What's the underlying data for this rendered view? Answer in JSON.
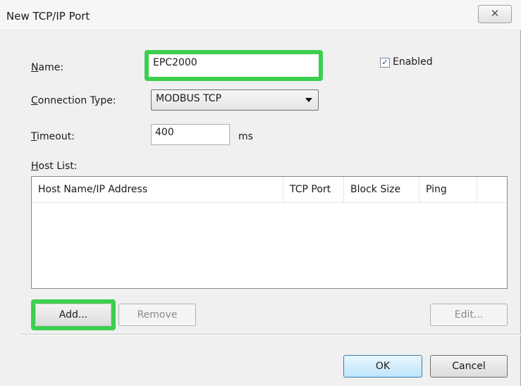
{
  "window": {
    "title": "New TCP/IP Port",
    "close_label": "✕"
  },
  "form": {
    "name_label": "Name:",
    "name_value": "EPC2000",
    "enabled_label": "Enabled",
    "enabled_checked": true,
    "connection_type_label": "Connection Type:",
    "connection_type_value": "MODBUS TCP",
    "timeout_label": "Timeout:",
    "timeout_value": "400",
    "timeout_unit": "ms",
    "host_list_label": "Host List:"
  },
  "host_list": {
    "columns": [
      "Host Name/IP Address",
      "TCP Port",
      "Block Size",
      "Ping"
    ],
    "rows": []
  },
  "buttons": {
    "add": "Add...",
    "remove": "Remove",
    "edit": "Edit...",
    "ok": "OK",
    "cancel": "Cancel"
  },
  "colors": {
    "highlight": "#3ccf4e",
    "check": "#1e3f8a"
  }
}
